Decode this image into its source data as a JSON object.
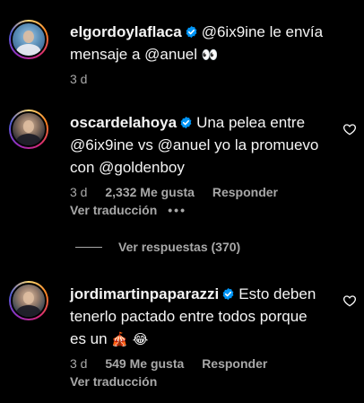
{
  "comments": [
    {
      "username": "elgordoylaflaca",
      "text_line1": "@6ix9ine le envía",
      "text_line2": "mensaje a @anuel",
      "emoji": "👀",
      "time": "3 d"
    },
    {
      "username": "oscardelahoya",
      "text_line1": "Una pelea entre",
      "text_line2": "@6ix9ine vs @anuel yo la promuevo",
      "text_line3": "con @goldenboy",
      "time": "3 d",
      "likes": "2,332 Me gusta",
      "reply": "Responder",
      "translate": "Ver traducción",
      "more": "•••"
    },
    {
      "username": "jordimartinpaparazzi",
      "text_line1": "Esto deben",
      "text_line2": "tenerlo pactado entre todos porque",
      "text_line3": "es un",
      "emoji1": "🎪",
      "emoji2": "😂",
      "time": "3 d",
      "likes": "549 Me gusta",
      "reply": "Responder",
      "translate": "Ver traducción"
    }
  ],
  "view_replies": "Ver respuestas (370)",
  "colors": {
    "background": "#000000",
    "text": "#f5f5f5",
    "muted": "#a8a8a8",
    "verified": "#0095f6"
  }
}
